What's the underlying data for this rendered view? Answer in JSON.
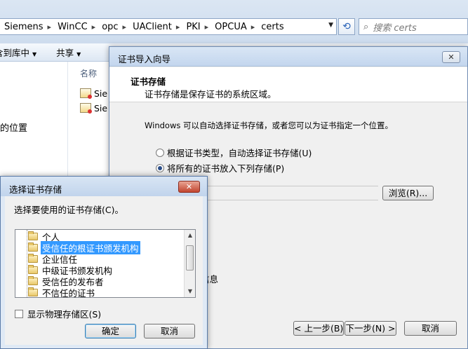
{
  "explorer": {
    "breadcrumbs": [
      "Siemens",
      "WinCC",
      "opc",
      "UAClient",
      "PKI",
      "OPCUA",
      "certs"
    ],
    "search_placeholder": "搜索 certs",
    "commands": {
      "include_in_library": "含到库中",
      "share": "共享"
    },
    "nav_item": "的位置",
    "column_name": "名称",
    "files": [
      {
        "name": "Sie"
      },
      {
        "name": "Sie"
      }
    ]
  },
  "wizard": {
    "title": "证书导入向导",
    "close_glyph": "✕",
    "header_title": "证书存储",
    "header_subtitle": "证书存储是保存证书的系统区域。",
    "description": "Windows 可以自动选择证书存储，或者您可以为证书指定一个位置。",
    "radio_auto": "根据证书类型，自动选择证书存储(U)",
    "radio_manual": "将所有的证书放入下列存储(P)",
    "browse_label": "浏览(R)...",
    "partial_text": "信息",
    "back_label": "< 上一步(B)",
    "next_label": "下一步(N) >",
    "cancel_label": "取消"
  },
  "store_dialog": {
    "title": "选择证书存储",
    "close_glyph": "✕",
    "prompt": "选择要使用的证书存储(C)。",
    "items": [
      {
        "label": "个人",
        "selected": false
      },
      {
        "label": "受信任的根证书颁发机构",
        "selected": true
      },
      {
        "label": "企业信任",
        "selected": false
      },
      {
        "label": "中级证书颁发机构",
        "selected": false
      },
      {
        "label": "受信任的发布者",
        "selected": false
      },
      {
        "label": "不信任的证书",
        "selected": false
      }
    ],
    "show_physical": "显示物理存储区(S)",
    "ok_label": "确定",
    "cancel_label": "取消"
  },
  "icons": {
    "search": "search-icon",
    "refresh": "refresh-icon",
    "folder": "folder-icon",
    "certificate": "certificate-file-icon"
  },
  "colors": {
    "selection": "#3399ff",
    "close_red": "#c2452f",
    "titlebar": "#c3d6ee"
  }
}
